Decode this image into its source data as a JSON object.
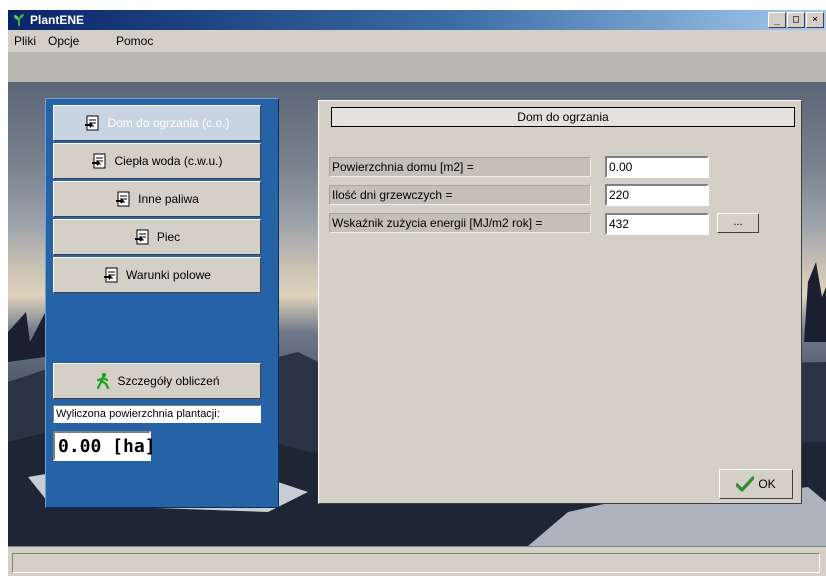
{
  "window": {
    "title": "PlantENE"
  },
  "window_buttons": {
    "minimize": "_",
    "maximize": "□",
    "close": "×"
  },
  "menu": {
    "items": [
      {
        "label": "Pliki"
      },
      {
        "label": "Opcje"
      },
      {
        "label": "Pomoc"
      }
    ]
  },
  "nav": {
    "buttons": [
      {
        "label": "Dom do ogrzania (c.o.)",
        "active": true
      },
      {
        "label": "Ciepła woda (c.w.u.)"
      },
      {
        "label": "Inne paliwa"
      },
      {
        "label": "Piec"
      },
      {
        "label": "Warunki polowe"
      }
    ],
    "details_button": "Szczegóły obliczeń",
    "calc_label": "Wyliczona powierzchnia plantacji:",
    "calc_value": "0.00 [ha]"
  },
  "form": {
    "header": "Dom do ogrzania",
    "fields": [
      {
        "label": "Powierzchnia domu [m2] =",
        "value": "0.00"
      },
      {
        "label": "Ilość dni grzewczych =",
        "value": "220"
      },
      {
        "label": "Wskaźnik zużycia energii [MJ/m2 rok] =",
        "value": "432"
      }
    ],
    "ellipsis_label": "...",
    "ok_label": "OK"
  },
  "colors": {
    "panel_blue": "#2563a6",
    "titlebar": "#0a246a",
    "ok_check": "#2e8b2e"
  },
  "icons": {
    "app": "plant-icon",
    "nav": "document-icon",
    "details": "walking-person-icon",
    "ok": "checkmark-icon"
  }
}
